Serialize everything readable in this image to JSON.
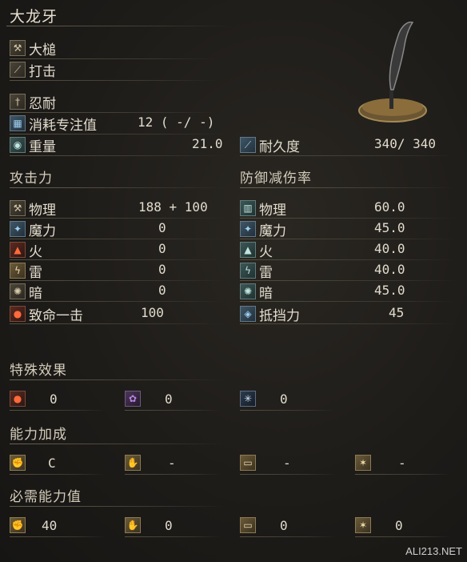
{
  "weapon": {
    "name": "大龙牙",
    "type": "大槌",
    "attack_type": "打击",
    "skill": "忍耐",
    "fp_cost_label": "消耗专注值",
    "fp_cost_value": "12 (  -/  -)",
    "weight_label": "重量",
    "weight_value": "21.0",
    "durability_label": "耐久度",
    "durability_value": "340/  340"
  },
  "attack": {
    "title": "攻击力",
    "rows": [
      {
        "label": "物理",
        "value": "188 +  100"
      },
      {
        "label": "魔力",
        "value": "0"
      },
      {
        "label": "火",
        "value": "0"
      },
      {
        "label": "雷",
        "value": "0"
      },
      {
        "label": "暗",
        "value": "0"
      },
      {
        "label": "致命一击",
        "value": "100"
      }
    ]
  },
  "defense": {
    "title": "防御减伤率",
    "rows": [
      {
        "label": "物理",
        "value": "60.0"
      },
      {
        "label": "魔力",
        "value": "45.0"
      },
      {
        "label": "火",
        "value": "40.0"
      },
      {
        "label": "雷",
        "value": "40.0"
      },
      {
        "label": "暗",
        "value": "45.0"
      },
      {
        "label": "抵挡力",
        "value": "45"
      }
    ]
  },
  "special": {
    "title": "特殊效果",
    "values": [
      "0",
      "0",
      "0"
    ]
  },
  "scaling": {
    "title": "能力加成",
    "values": [
      "C",
      "-",
      "-",
      "-"
    ]
  },
  "requirements": {
    "title": "必需能力值",
    "values": [
      "40",
      "0",
      "0",
      "0"
    ]
  },
  "watermark": "ALI213.NET"
}
